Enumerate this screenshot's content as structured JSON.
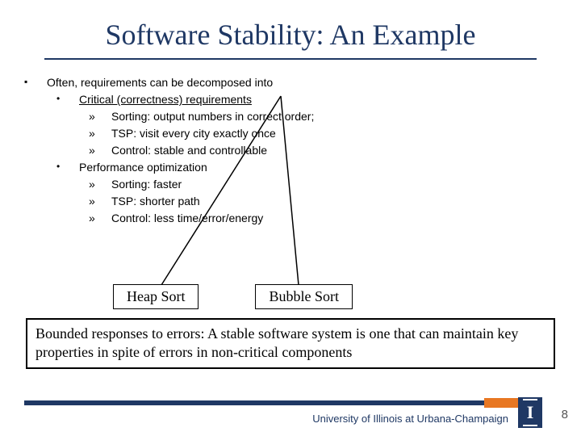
{
  "title": "Software Stability: An Example",
  "intro": "Often, requirements can be decomposed into",
  "critical": {
    "heading": "Critical (correctness) requirements",
    "items": [
      "Sorting: output numbers in correct order;",
      "TSP: visit every city exactly once",
      "Control: stable and controllable"
    ]
  },
  "performance": {
    "heading": "Performance optimization",
    "items": [
      "Sorting: faster",
      "TSP: shorter path",
      "Control: less time/error/energy"
    ]
  },
  "box1": "Heap Sort",
  "box2": "Bubble Sort",
  "definition": "Bounded responses to errors: A stable software system is one that can maintain key properties in spite of errors in non-critical components",
  "footer": "University of Illinois at Urbana-Champaign",
  "page": "8"
}
